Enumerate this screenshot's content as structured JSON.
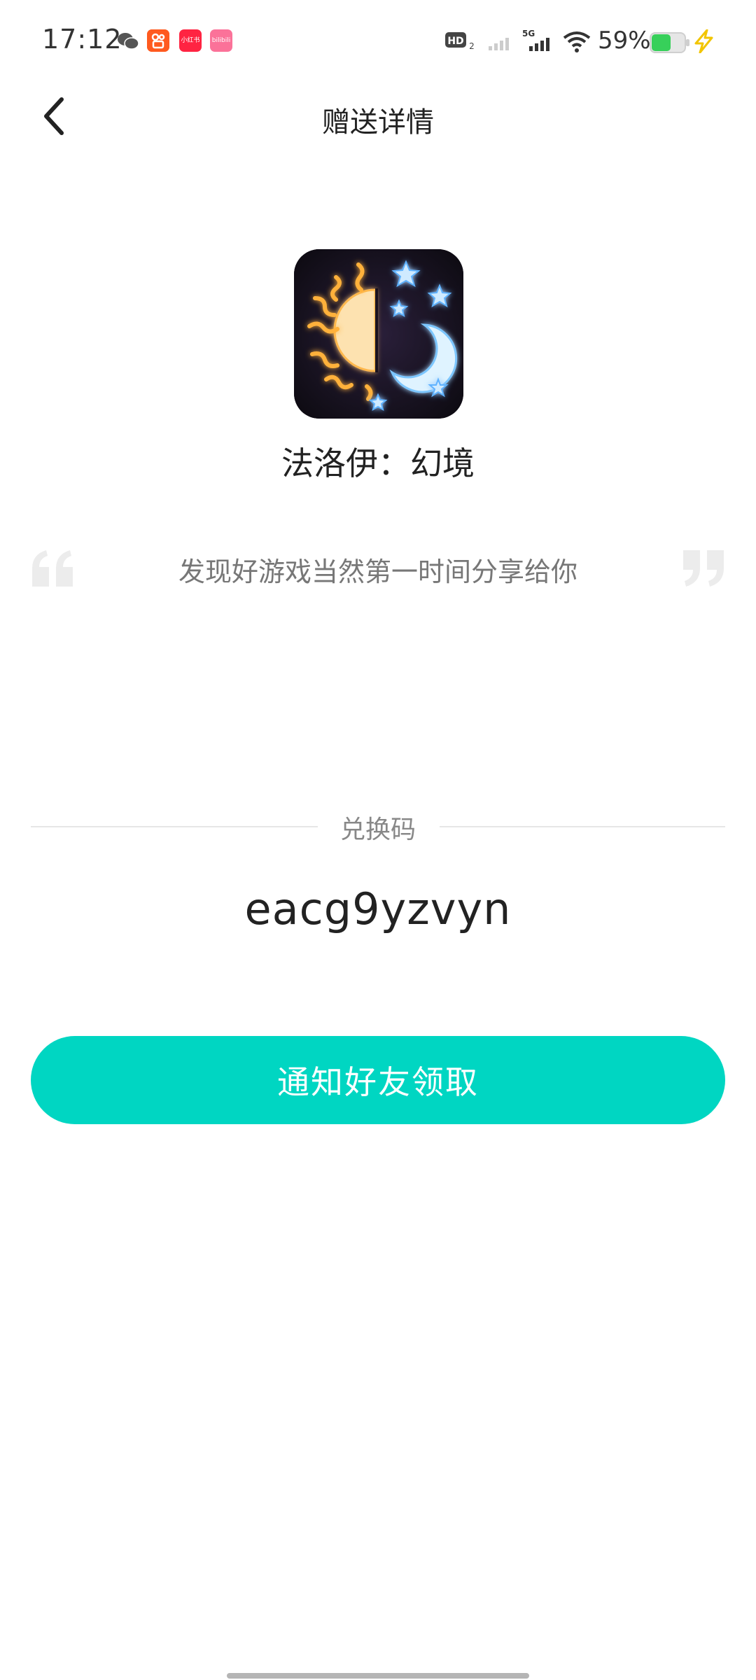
{
  "status_bar": {
    "time": "17:12",
    "battery_percent": "59%",
    "app_xhs": "小红书",
    "app_bili": "bilibili",
    "battery_level": 0.59
  },
  "header": {
    "title": "赠送详情"
  },
  "game": {
    "name": "法洛伊：幻境"
  },
  "share": {
    "quote": "发现好游戏当然第一时间分享给你"
  },
  "redeem": {
    "label": "兑换码",
    "code": "eacg9yzvyn"
  },
  "actions": {
    "notify_button": "通知好友领取"
  },
  "colors": {
    "accent": "#00d6c2",
    "text_primary": "#222222",
    "text_secondary": "#777777"
  }
}
